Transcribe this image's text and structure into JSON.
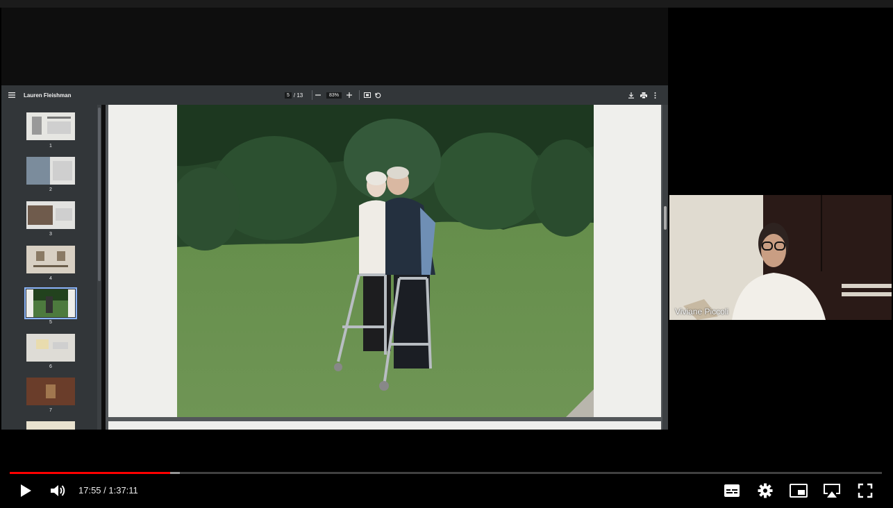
{
  "pdf_viewer": {
    "title": "Lauren Fleishman",
    "current_page": "5",
    "total_pages": "/ 13",
    "zoom": "83%",
    "thumbnails": [
      {
        "label": "1"
      },
      {
        "label": "2"
      },
      {
        "label": "3"
      },
      {
        "label": "4"
      },
      {
        "label": "5",
        "selected": true
      },
      {
        "label": "6"
      },
      {
        "label": "7"
      }
    ]
  },
  "participant": {
    "name": "Viviane Piccoli"
  },
  "player": {
    "time": "17:55 / 1:37:11",
    "played_fraction": 0.184,
    "buffered_fraction": 0.195,
    "accent_color": "#ff0000"
  }
}
